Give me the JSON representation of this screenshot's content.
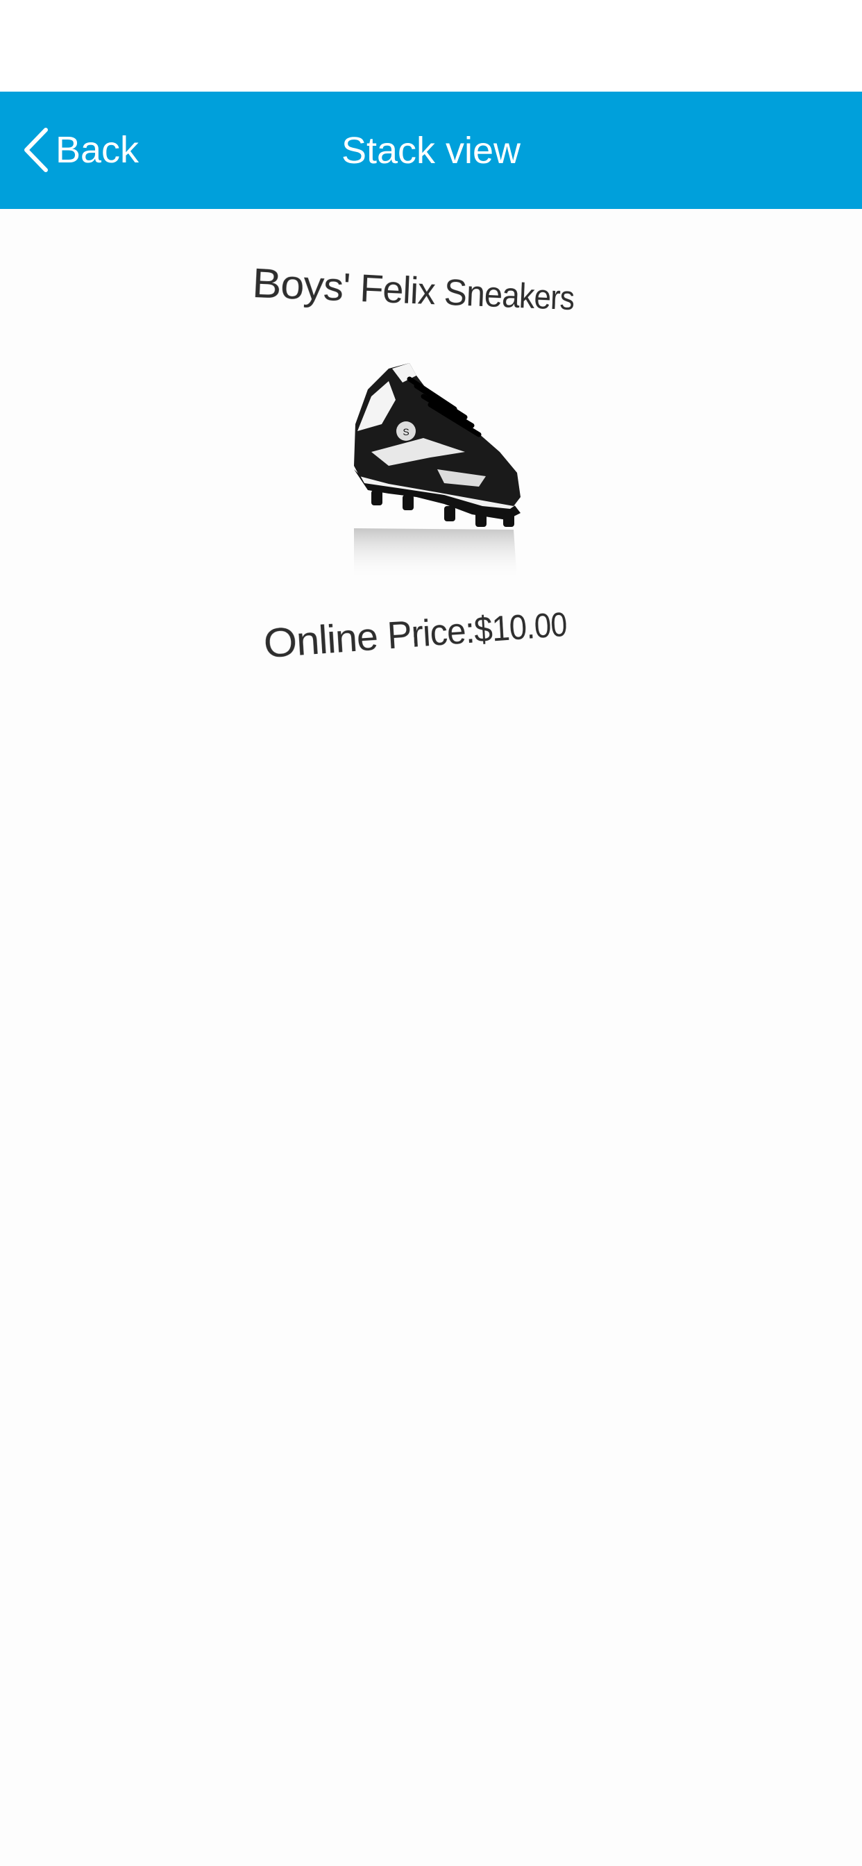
{
  "nav": {
    "back_label": "Back",
    "title": "Stack view",
    "bar_color": "#00a0db"
  },
  "product": {
    "name": "Boys' Felix Sneakers",
    "price_label": "Online Price:$10.00",
    "image_icon": "sneaker-image"
  }
}
